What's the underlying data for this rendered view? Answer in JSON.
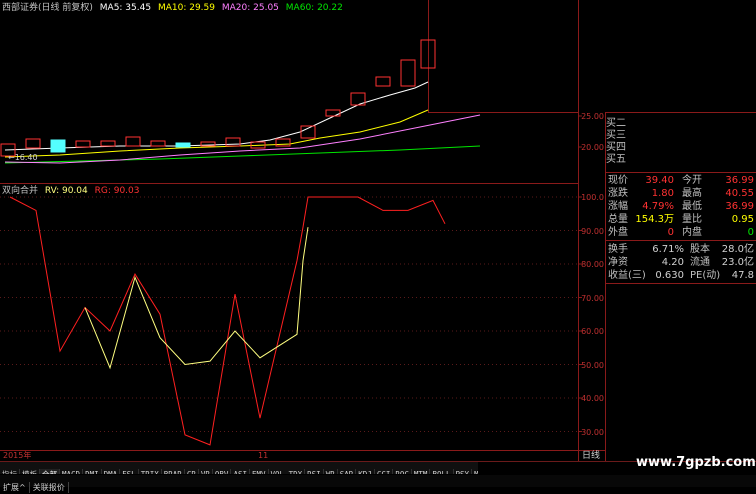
{
  "main_header": {
    "title": "西部证券(日线 前复权)",
    "ma5": "MA5: 35.45",
    "ma10": "MA10: 29.59",
    "ma20": "MA20: 25.05",
    "ma60": "MA60: 20.22"
  },
  "main_axis": {
    "t25": "25.00",
    "t20": "20.00"
  },
  "low_marker": "←16.40",
  "order_book": [
    "买二",
    "买三",
    "买四",
    "买五"
  ],
  "quote": {
    "now_label": "现价",
    "now_val": "39.40",
    "open_label": "今开",
    "open_val": "36.99",
    "chg_label": "涨跌",
    "chg_val": "1.80",
    "high_label": "最高",
    "high_val": "40.55",
    "pct_label": "涨幅",
    "pct_val": "4.79%",
    "low_label": "最低",
    "low_val": "36.99",
    "vol_label": "总量",
    "vol_val": "154.3万",
    "ratio_label": "量比",
    "ratio_val": "0.95",
    "out_label": "外盘",
    "out_val": "0",
    "in_label": "内盘",
    "in_val": "0",
    "turn_label": "换手",
    "turn_val": "6.71%",
    "cap_label": "股本",
    "cap_val": "28.0亿",
    "nav_label": "净资",
    "nav_val": "4.20",
    "float_label": "流通",
    "float_val": "23.0亿",
    "eps_label": "收益(三)",
    "eps_val": "0.630",
    "pe_label": "PE(动)",
    "pe_val": "47.8"
  },
  "indicator": {
    "title": "双向合并",
    "rv": "RV: 90.04",
    "rg": "RG: 90.03",
    "ticks": [
      "100.0",
      "90.00",
      "80.00",
      "70.00",
      "60.00",
      "50.00",
      "40.00",
      "30.00"
    ]
  },
  "xaxis": {
    "year": "2015年",
    "month": "11"
  },
  "period": "日线",
  "tabs": [
    "指标",
    "模板",
    "全部",
    "MACD",
    "DMI",
    "DMA",
    "FSL",
    "TRIX",
    "BRAR",
    "CR",
    "VR",
    "OBV",
    "ASI",
    "EMV",
    "VOL-TDX",
    "RSI",
    "WR",
    "SAR",
    "KDJ",
    "CCI",
    "ROC",
    "MTM",
    "BOLL",
    "PSY",
    "MCST"
  ],
  "bottom_tabs": [
    "扩展^",
    "关联报价"
  ],
  "watermark": "www.7gpzb.com",
  "colors": {
    "up": "#ff3232",
    "down": "#54ffff",
    "ma5": "#ffffff",
    "ma10": "#ffff00",
    "ma20": "#ff80ff",
    "ma60": "#00e600",
    "rv": "#ffff80",
    "rg": "#ff2020"
  },
  "series": {
    "rg": [
      100,
      96,
      54,
      67,
      60,
      77,
      65,
      29,
      26,
      71,
      34,
      81,
      null,
      100,
      100,
      100,
      100,
      96,
      96,
      99,
      92
    ],
    "rv": [
      null,
      null,
      null,
      67,
      49,
      76,
      58,
      50,
      51,
      60,
      52,
      59,
      81,
      91,
      null,
      null,
      null,
      null,
      null,
      null,
      null
    ]
  }
}
